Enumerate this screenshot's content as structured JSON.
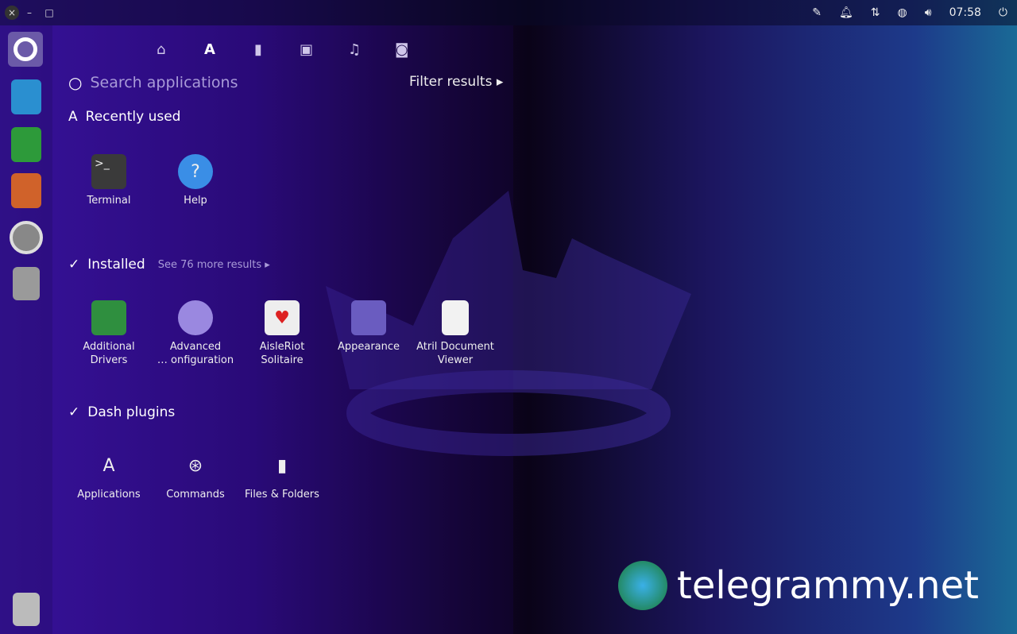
{
  "topbar": {
    "clock": "07:58",
    "icons": [
      "pen-icon",
      "bell-icon",
      "network-icon",
      "globe-icon",
      "volume-icon",
      "power-icon"
    ]
  },
  "window_controls": {
    "close": "×",
    "minimize": "–",
    "maximize": "□"
  },
  "lenses": [
    "home-lens",
    "applications-lens",
    "files-lens",
    "video-lens",
    "music-lens",
    "photo-lens"
  ],
  "search": {
    "placeholder": "Search applications"
  },
  "filter": {
    "label": "Filter results ▸"
  },
  "recent": {
    "title": "Recently used",
    "apps": [
      {
        "label": "Terminal"
      },
      {
        "label": "Help"
      }
    ]
  },
  "installed": {
    "title": "Installed",
    "more": "See 76 more results ▸",
    "apps": [
      {
        "label1": "Additional",
        "label2": "Drivers"
      },
      {
        "label1": "Advanced",
        "label2": "… onfiguration"
      },
      {
        "label1": "AisleRiot",
        "label2": "Solitaire"
      },
      {
        "label1": "Appearance",
        "label2": ""
      },
      {
        "label1": "Atril Document",
        "label2": "Viewer"
      }
    ]
  },
  "plugins": {
    "title": "Dash plugins",
    "apps": [
      {
        "label": "Applications"
      },
      {
        "label": "Commands"
      },
      {
        "label": "Files & Folders"
      }
    ]
  },
  "watermark": {
    "text": "telegrammy.net"
  }
}
